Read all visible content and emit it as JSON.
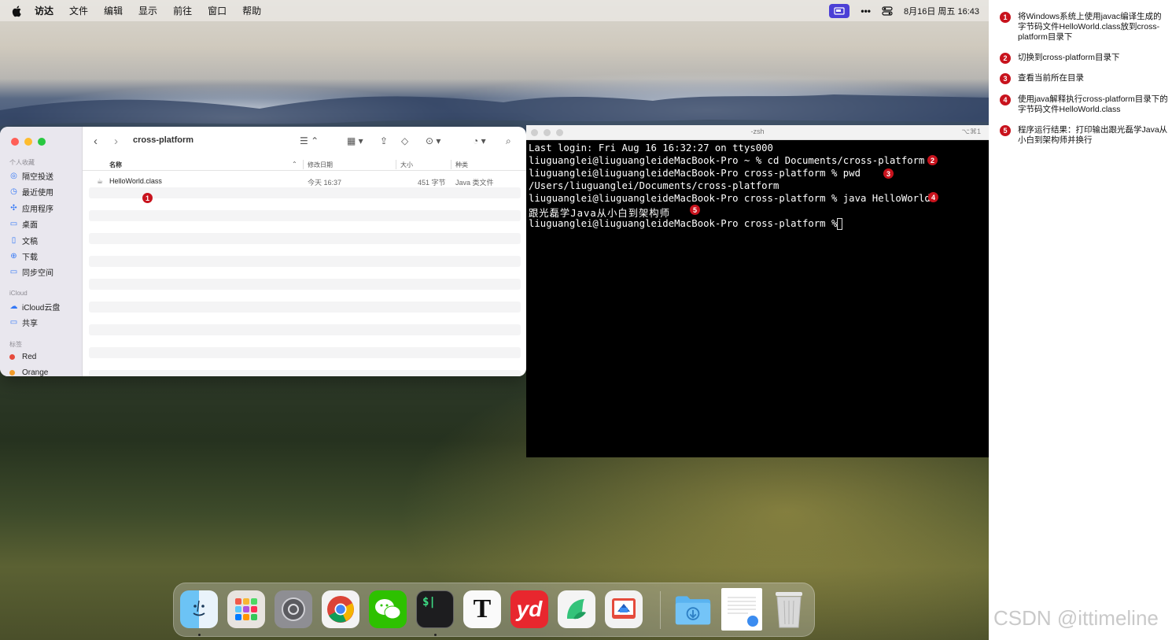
{
  "menubar": {
    "items": [
      "访达",
      "文件",
      "编辑",
      "显示",
      "前往",
      "窗口",
      "帮助"
    ],
    "datetime": "8月16日 周五  16:43"
  },
  "finder": {
    "title": "cross-platform",
    "sidebar": {
      "favorites_header": "个人收藏",
      "favorites": [
        "隔空投送",
        "最近使用",
        "应用程序",
        "桌面",
        "文稿",
        "下载",
        "同步空间"
      ],
      "icloud_header": "iCloud",
      "icloud": [
        "iCloud云盘",
        "共享"
      ],
      "tags_header": "标签",
      "tags": [
        {
          "label": "Red",
          "color": "#e64a3c"
        },
        {
          "label": "Orange",
          "color": "#f29b2a"
        }
      ]
    },
    "columns": {
      "name": "名称",
      "modified": "修改日期",
      "size": "大小",
      "kind": "种类"
    },
    "files": [
      {
        "name": "HelloWorld.class",
        "modified": "今天 16:37",
        "size": "451 字节",
        "kind": "Java 类文件"
      }
    ]
  },
  "terminal": {
    "title": "-zsh",
    "shortcut": "⌥⌘1",
    "lines": [
      "Last login: Fri Aug 16 16:32:27 on ttys000",
      "liuguanglei@liuguangleideMacBook-Pro ~ % cd Documents/cross-platform",
      "liuguanglei@liuguangleideMacBook-Pro cross-platform % pwd",
      "/Users/liuguanglei/Documents/cross-platform",
      "liuguanglei@liuguangleideMacBook-Pro cross-platform % java HelloWorld",
      "跟光磊学Java从小白到架构师",
      "liuguanglei@liuguangleideMacBook-Pro cross-platform % "
    ]
  },
  "badges": [
    "1",
    "2",
    "3",
    "4",
    "5"
  ],
  "notes": [
    {
      "num": "1",
      "text": "将Windows系统上使用javac编译生成的字节码文件HelloWorld.class放到cross-platform目录下"
    },
    {
      "num": "2",
      "text": "切换到cross-platform目录下"
    },
    {
      "num": "3",
      "text": "查看当前所在目录"
    },
    {
      "num": "4",
      "text": "使用java解释执行cross-platform目录下的字节码文件HelloWorld.class"
    },
    {
      "num": "5",
      "text": "程序运行结果：打印输出跟光磊学Java从小白到架构师并换行"
    }
  ],
  "dock": {
    "apps": [
      "finder-icon",
      "launchpad-icon",
      "system-settings-icon",
      "chrome-icon",
      "wechat-icon",
      "terminal-icon",
      "typora-icon",
      "youdao-icon",
      "feishu-icon",
      "remote-desktop-icon",
      "downloads-folder-icon",
      "document-icon",
      "trash-icon"
    ],
    "terminal_glyph": "$|",
    "typora_glyph": "T",
    "youdao_glyph": "yd"
  },
  "watermark": "CSDN @ittimeline"
}
